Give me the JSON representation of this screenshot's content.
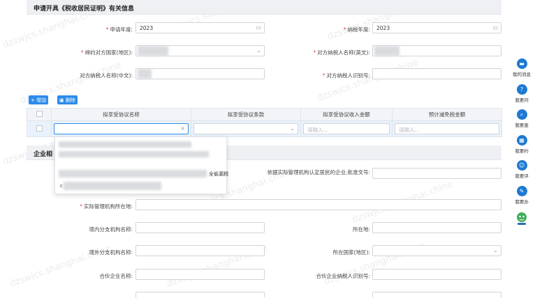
{
  "section1": {
    "title": "申请开具《税收居民证明》有关信息"
  },
  "form1": {
    "apply_year_label": "申请年度:",
    "apply_year_value": "2023",
    "tax_year_label": "纳税年度:",
    "tax_year_value": "2023",
    "treaty_country_label": "缔约对方国家(地区):",
    "counterpart_name_en_label": "对方纳税人名称(英文):",
    "counterpart_name_cn_label": "对方纳税人名称(中文):",
    "counterpart_tin_label": "对方纳税人识别号:"
  },
  "toolbar": {
    "add_label": "+ 增加",
    "delete_label": "删除"
  },
  "agreement_table": {
    "headers": [
      "拟享受协议名称",
      "拟享受协议条款",
      "拟享受协议收入金额",
      "预计减免税金额"
    ],
    "income_placeholder": "请输入...",
    "relief_placeholder": "请输入..."
  },
  "dropdown": {
    "partial_text": "全偷漏税",
    "partial_mark": "c"
  },
  "section2": {
    "title": "企业相"
  },
  "form2": {
    "effective_mgmt_label": "依据实际管理机构认定居民的企业,批准文号:",
    "mgmt_location_label": "实际管理机构所在地:",
    "domestic_branch_label": "境内分支机构名称:",
    "domestic_location_label": "所在地:",
    "foreign_branch_label": "境外分支机构名称:",
    "foreign_country_label": "所在国家(地区):",
    "partner_name_label": "合伙企业名称:",
    "partner_tin_label": "合伙企业纳税人识别号:"
  },
  "watermark": "dzswjcs.shanghai.chine",
  "sidebar": {
    "items": [
      {
        "label": "我的消息",
        "icon": "message-icon"
      },
      {
        "label": "我要问",
        "icon": "question-icon"
      },
      {
        "label": "我要查",
        "icon": "search-icon"
      },
      {
        "label": "我要约",
        "icon": "calendar-icon"
      },
      {
        "label": "我要评",
        "icon": "rating-icon"
      },
      {
        "label": "我要办",
        "icon": "edit-icon"
      }
    ],
    "accent_color": "#1e79d2"
  }
}
